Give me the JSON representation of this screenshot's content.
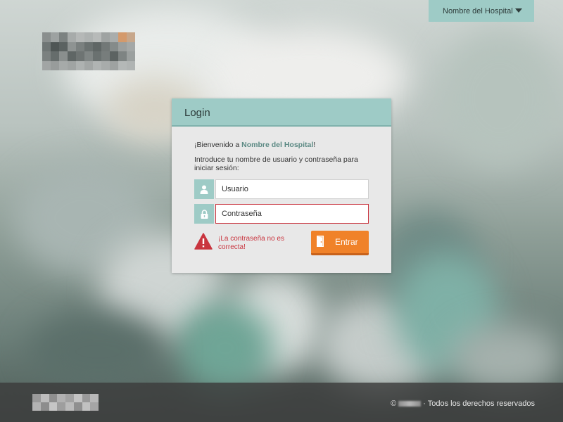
{
  "top_bar": {
    "hospital_selector": "Nombre del Hospital"
  },
  "login": {
    "title": "Login",
    "welcome_prefix": "¡Bienvenido a ",
    "hospital_name": "Nombre del Hospital",
    "welcome_suffix": "!",
    "instructions": "Introduce tu nombre de usuario y contraseña para iniciar sesión:",
    "username_placeholder": "Usuario",
    "password_placeholder": "Contraseña",
    "error_message": "¡La contraseña no es correcta!",
    "enter_label": "Entrar"
  },
  "footer": {
    "copyright_symbol": "©",
    "rights_text": "· Todos los derechos reservados"
  },
  "colors": {
    "accent_teal": "#9ecbc6",
    "enter_orange": "#f08229",
    "error_red": "#c9353f"
  },
  "icons": [
    "user-icon",
    "lock-icon",
    "warning-icon",
    "door-icon",
    "caret-down-icon"
  ]
}
